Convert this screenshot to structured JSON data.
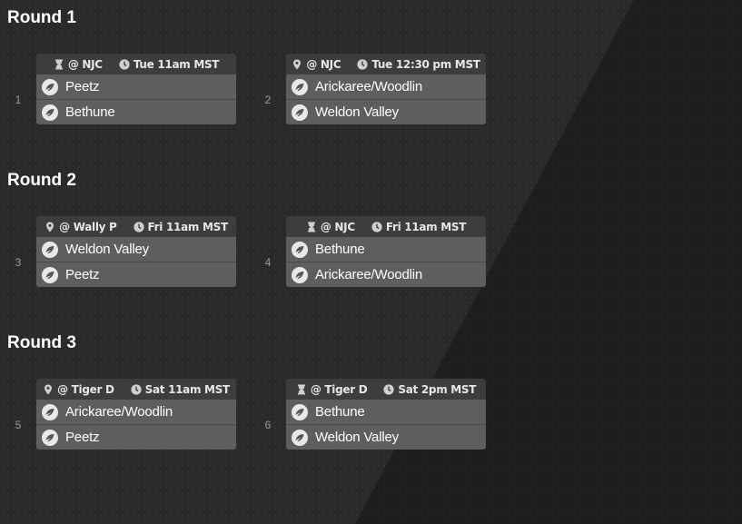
{
  "rounds": [
    {
      "title": "Round 1",
      "games": [
        {
          "number": "1",
          "info_icon": "hourglass-icon",
          "venue": "@ NJC",
          "time": "Tue 11am MST",
          "teams": [
            "Peetz",
            "Bethune"
          ]
        },
        {
          "number": "2",
          "info_icon": "location-pin-icon",
          "venue": "@ NJC",
          "time": "Tue 12:30 pm MST",
          "teams": [
            "Arickaree/Woodlin",
            "Weldon Valley"
          ]
        }
      ]
    },
    {
      "title": "Round 2",
      "games": [
        {
          "number": "3",
          "info_icon": "location-pin-icon",
          "venue": "@ Wally P",
          "time": "Fri 11am MST",
          "teams": [
            "Weldon Valley",
            "Peetz"
          ]
        },
        {
          "number": "4",
          "info_icon": "hourglass-icon",
          "venue": "@ NJC",
          "time": "Fri 11am MST",
          "teams": [
            "Bethune",
            "Arickaree/Woodlin"
          ]
        }
      ]
    },
    {
      "title": "Round 3",
      "games": [
        {
          "number": "5",
          "info_icon": "location-pin-icon",
          "venue": "@ Tiger D",
          "time": "Sat 11am MST",
          "teams": [
            "Arickaree/Woodlin",
            "Peetz"
          ]
        },
        {
          "number": "6",
          "info_icon": "hourglass-icon",
          "venue": "@ Tiger D",
          "time": "Sat 2pm MST",
          "teams": [
            "Bethune",
            "Weldon Valley"
          ]
        }
      ]
    }
  ],
  "colors": {
    "background": "#2a2a2a",
    "card_header": "#3d3d3d",
    "team_row": "#5e5e5e",
    "game_number": "#9a9a9a"
  }
}
